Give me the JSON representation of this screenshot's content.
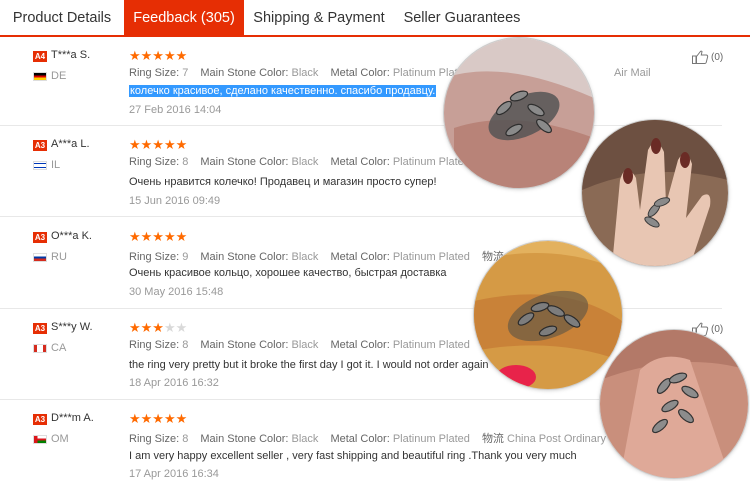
{
  "tabs": [
    {
      "label": "Product Details",
      "active": false
    },
    {
      "label": "Feedback (305)",
      "active": true
    },
    {
      "label": "Shipping & Payment",
      "active": false
    },
    {
      "label": "Seller Guarantees",
      "active": false
    }
  ],
  "attr_labels": {
    "ring_size": "Ring Size:",
    "stone": "Main Stone Color:",
    "metal": "Metal Color:",
    "ship_cn": "物流"
  },
  "reviews": [
    {
      "level": "A4",
      "name": "T***a S.",
      "country": "DE",
      "rating": 5,
      "ring_size": "7",
      "stone": "Black",
      "metal": "Platinum Plated",
      "shipping": "Air Mail",
      "text": "колечко красивое, сделано качественно. спасибо продавцу.",
      "date": "27 Feb 2016 14:04",
      "useful": "(0)"
    },
    {
      "level": "A3",
      "name": "A***a L.",
      "country": "IL",
      "rating": 5,
      "ring_size": "8",
      "stone": "Black",
      "metal": "Platinum Plated",
      "text": "Очень нравится колечко! Продавец и магазин просто супер!",
      "date": "15 Jun 2016 09:49"
    },
    {
      "level": "A3",
      "name": "O***a K.",
      "country": "RU",
      "rating": 5,
      "ring_size": "9",
      "stone": "Black",
      "metal": "Platinum Plated",
      "text": "Очень красивое кольцо, хорошее качество, быстрая доставка",
      "date": "30 May 2016 15:48"
    },
    {
      "level": "A3",
      "name": "S***y W.",
      "country": "CA",
      "rating": 3,
      "ring_size": "8",
      "stone": "Black",
      "metal": "Platinum Plated",
      "text": "the ring very pretty but it broke the first day I got it. I would not order again",
      "date": "18 Apr 2016 16:32",
      "useful": "(0)"
    },
    {
      "level": "A3",
      "name": "D***m A.",
      "country": "OM",
      "rating": 5,
      "ring_size": "8",
      "stone": "Black",
      "metal": "Platinum Plated",
      "shipping": "China Post Ordinary Smal...",
      "text": "I am very happy excellent seller , very fast shipping and beautiful ring .Thank you very much",
      "date": "17 Apr 2016 16:34"
    }
  ],
  "colors": {
    "accent": "#e62e04",
    "star": "#ff6a00",
    "selection": "#3399ff"
  }
}
